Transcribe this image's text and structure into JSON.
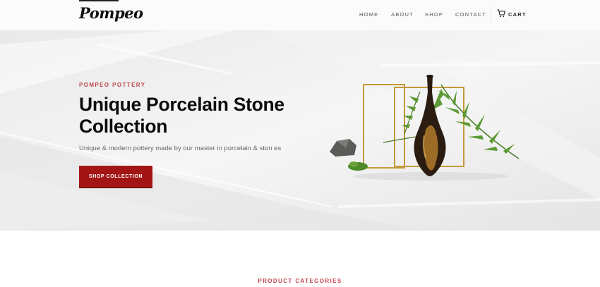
{
  "header": {
    "logo": "Pompeo",
    "nav": [
      {
        "label": "HOME"
      },
      {
        "label": "ABOUT"
      },
      {
        "label": "SHOP"
      },
      {
        "label": "CONTACT"
      }
    ],
    "cart_label": "CART",
    "cart_icon": "cart-icon"
  },
  "hero": {
    "eyebrow": "POMPEO POTTERY",
    "headline": "Unique Porcelain Stone Collection",
    "subtext": "Unique & modern pottery made by our master in porcelain & ston es",
    "cta_label": "SHOP COLLECTION",
    "colors": {
      "accent": "#c0444b",
      "button": "#a31515"
    }
  },
  "section": {
    "title": "PRODUCT CATEGORIES"
  }
}
